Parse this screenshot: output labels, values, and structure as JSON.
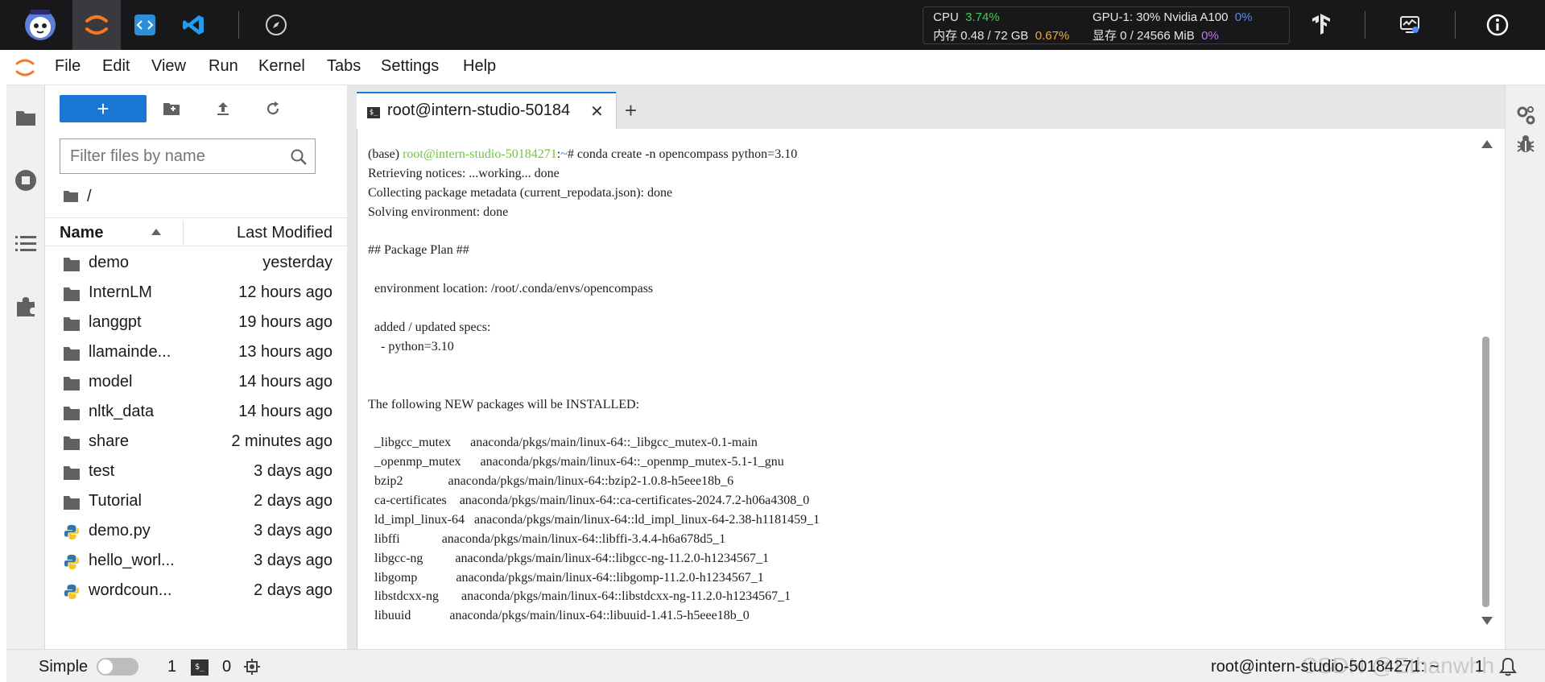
{
  "topbar": {
    "monitor": {
      "cpu_label": "CPU",
      "cpu_value": "3.74%",
      "mem_label": "内存 0.48 / 72 GB",
      "mem_value": "0.67%",
      "gpu_label": "GPU-1: 30% Nvidia A100",
      "gpu_value": "0%",
      "vram_label": "显存 0 / 24566 MiB",
      "vram_value": "0%"
    },
    "icons": [
      "intern-mascot-logo-icon",
      "jupyter-icon",
      "code-editor-icon",
      "vscode-icon",
      "compass-icon",
      "tensorflow-icon",
      "monitor-icon",
      "info-icon"
    ]
  },
  "menu": {
    "items": [
      "File",
      "Edit",
      "View",
      "Run",
      "Kernel",
      "Tabs",
      "Settings",
      "Help"
    ]
  },
  "filebrowser": {
    "new_label": "+",
    "filter_placeholder": "Filter files by name",
    "breadcrumb": "/",
    "header_name": "Name",
    "header_modified": "Last Modified",
    "files": [
      {
        "name": "demo",
        "modified": "yesterday",
        "type": "folder"
      },
      {
        "name": "InternLM",
        "modified": "12 hours ago",
        "type": "folder"
      },
      {
        "name": "langgpt",
        "modified": "19 hours ago",
        "type": "folder"
      },
      {
        "name": "llamainde...",
        "modified": "13 hours ago",
        "type": "folder"
      },
      {
        "name": "model",
        "modified": "14 hours ago",
        "type": "folder"
      },
      {
        "name": "nltk_data",
        "modified": "14 hours ago",
        "type": "folder"
      },
      {
        "name": "share",
        "modified": "2 minutes ago",
        "type": "folder"
      },
      {
        "name": "test",
        "modified": "3 days ago",
        "type": "folder"
      },
      {
        "name": "Tutorial",
        "modified": "2 days ago",
        "type": "folder"
      },
      {
        "name": "demo.py",
        "modified": "3 days ago",
        "type": "python"
      },
      {
        "name": "hello_worl...",
        "modified": "3 days ago",
        "type": "python"
      },
      {
        "name": "wordcoun...",
        "modified": "2 days ago",
        "type": "python"
      }
    ]
  },
  "terminal": {
    "tab_title": "root@intern-studio-50184",
    "tab_close": "✕",
    "tab_add": "+",
    "tab_icon_text": "$_",
    "prompt_env": "(base) ",
    "prompt_host": "root@intern-studio-50184271",
    "prompt_sep": ":",
    "prompt_path": "~",
    "prompt_cmd": "# conda create -n opencompass python=3.10",
    "lines": [
      "Retrieving notices: ...working... done",
      "Collecting package metadata (current_repodata.json): done",
      "Solving environment: done",
      "",
      "## Package Plan ##",
      "",
      "  environment location: /root/.conda/envs/opencompass",
      "",
      "  added / updated specs:",
      "    - python=3.10",
      "",
      "",
      "The following NEW packages will be INSTALLED:",
      "",
      "  _libgcc_mutex      anaconda/pkgs/main/linux-64::_libgcc_mutex-0.1-main",
      "  _openmp_mutex      anaconda/pkgs/main/linux-64::_openmp_mutex-5.1-1_gnu",
      "  bzip2              anaconda/pkgs/main/linux-64::bzip2-1.0.8-h5eee18b_6",
      "  ca-certificates    anaconda/pkgs/main/linux-64::ca-certificates-2024.7.2-h06a4308_0",
      "  ld_impl_linux-64   anaconda/pkgs/main/linux-64::ld_impl_linux-64-2.38-h1181459_1",
      "  libffi             anaconda/pkgs/main/linux-64::libffi-3.4.4-h6a678d5_1",
      "  libgcc-ng          anaconda/pkgs/main/linux-64::libgcc-ng-11.2.0-h1234567_1",
      "  libgomp            anaconda/pkgs/main/linux-64::libgomp-11.2.0-h1234567_1",
      "  libstdcxx-ng       anaconda/pkgs/main/linux-64::libstdcxx-ng-11.2.0-h1234567_1",
      "  libuuid            anaconda/pkgs/main/linux-64::libuuid-1.41.5-h5eee18b_0"
    ]
  },
  "statusbar": {
    "mode_label": "Simple",
    "kernels": "1",
    "terminal_icon_text": "$_",
    "terminals": "0",
    "right_text": "root@intern-studio-50184271: ~",
    "right_num": "1",
    "watermark": "CSDN @Ethanwhh"
  }
}
